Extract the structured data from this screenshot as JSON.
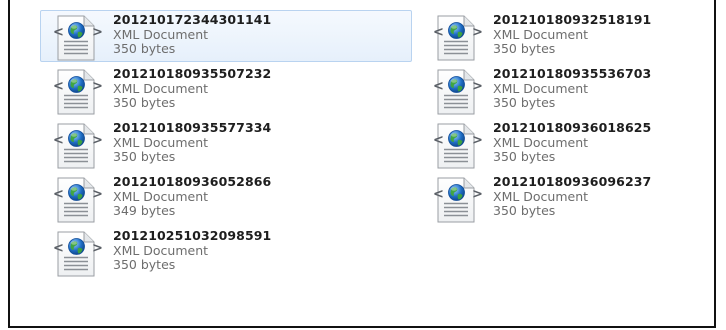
{
  "files": [
    {
      "name": "201210172344301141",
      "type": "XML Document",
      "size": "350 bytes",
      "selected": true
    },
    {
      "name": "201210180932518191",
      "type": "XML Document",
      "size": "350 bytes",
      "selected": false
    },
    {
      "name": "201210180935507232",
      "type": "XML Document",
      "size": "350 bytes",
      "selected": false
    },
    {
      "name": "201210180935536703",
      "type": "XML Document",
      "size": "350 bytes",
      "selected": false
    },
    {
      "name": "201210180935577334",
      "type": "XML Document",
      "size": "350 bytes",
      "selected": false
    },
    {
      "name": "201210180936018625",
      "type": "XML Document",
      "size": "350 bytes",
      "selected": false
    },
    {
      "name": "201210180936052866",
      "type": "XML Document",
      "size": "349 bytes",
      "selected": false
    },
    {
      "name": "201210180936096237",
      "type": "XML Document",
      "size": "350 bytes",
      "selected": false
    },
    {
      "name": "201210251032098591",
      "type": "XML Document",
      "size": "350 bytes",
      "selected": false
    }
  ],
  "icon": "xml-document-icon",
  "colors": {
    "selection_fill": "#e6f0fb",
    "selection_border": "#b9d3f0",
    "name_text": "#1e1e1e",
    "meta_text": "#6d6d6d",
    "globe_blue": "#1f6fc6",
    "globe_green": "#3fa53a"
  }
}
